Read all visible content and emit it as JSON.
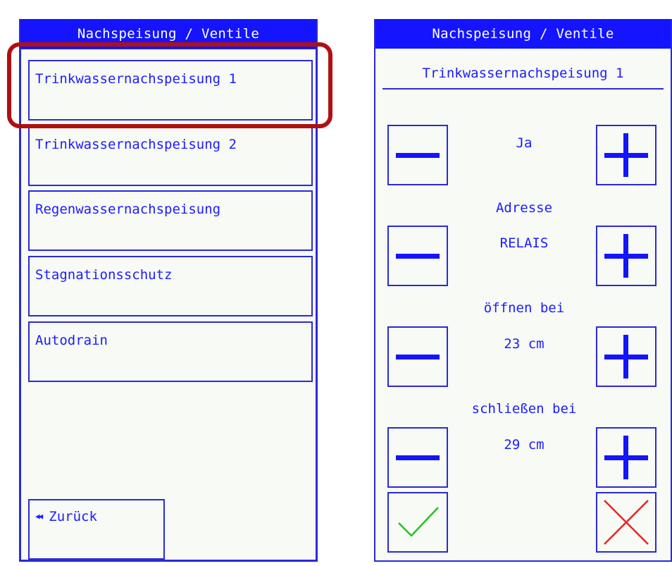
{
  "left": {
    "header": "Nachspeisung / Ventile",
    "menu_items": [
      {
        "label": "Trinkwassernachspeisung 1"
      },
      {
        "label": "Trinkwassernachspeisung 2"
      },
      {
        "label": "Regenwassernachspeisung"
      },
      {
        "label": "Stagnationsschutz"
      },
      {
        "label": "Autodrain"
      }
    ],
    "back_label": "Zurück"
  },
  "right": {
    "header": "Nachspeisung / Ventile",
    "subtitle": "Trinkwassernachspeisung 1",
    "settings": [
      {
        "label": "",
        "value": "Ja"
      },
      {
        "label": "Adresse",
        "value": "RELAIS"
      },
      {
        "label": "öffnen bei",
        "value": "23 cm"
      },
      {
        "label": "schließen bei",
        "value": "29 cm"
      }
    ]
  },
  "colors": {
    "accent": "#1414ff",
    "border": "#2a2ad8",
    "background": "#f7faf5",
    "highlight": "#b01010",
    "confirm": "#22c322",
    "cancel": "#f02020"
  },
  "icons": {
    "back": "double-left-arrow-icon",
    "minus": "minus-icon",
    "plus": "plus-icon",
    "confirm": "checkmark-icon",
    "cancel": "x-icon"
  }
}
